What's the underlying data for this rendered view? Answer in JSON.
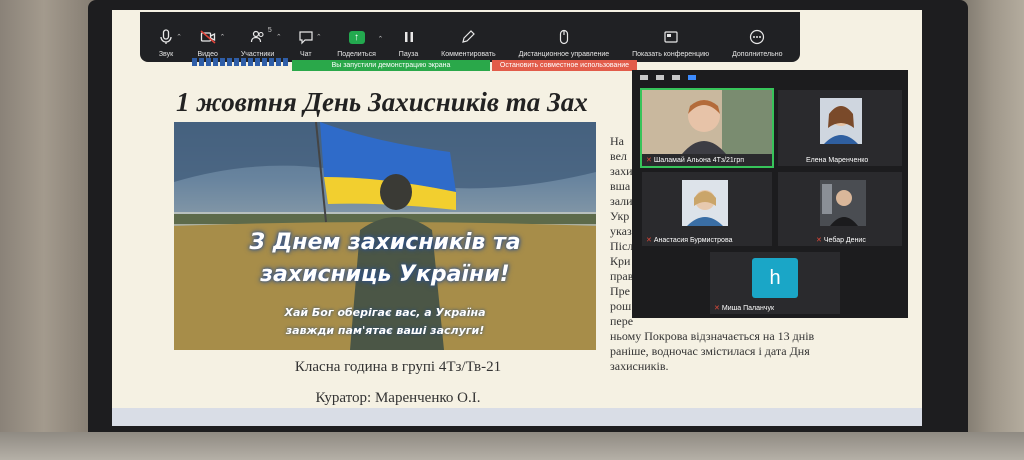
{
  "toolbar": {
    "audio": "Звук",
    "video": "Видео",
    "participants": "Участники",
    "participants_count": "5",
    "chat": "Чат",
    "share": "Поделиться",
    "pause": "Пауза",
    "annotate": "Комментировать",
    "remote_control": "Дистанционное управление",
    "show_conference": "Показать конференцию",
    "more": "Дополнительно"
  },
  "banners": {
    "sharing": "Вы запустили демонстрацию экрана",
    "stop": "Остановить совместное использование"
  },
  "slide": {
    "title": "1 жовтня День Захисників та Зах",
    "hero_line1": "З Днем захисників та",
    "hero_line2": "захисниць України!",
    "hero_sub1": "Хай Бог оберігає вас, а Україна",
    "hero_sub2": "завжди пам'ятає ваші заслуги!",
    "body_lines": [
      "На",
      "вел",
      "захи",
      "вша",
      "зали",
      "Укр",
      "указ",
      "Післ",
      "Кри",
      "прав",
      "Пре",
      "рош",
      "пере",
      "ньому Покрова відзначається на 13 днів",
      "раніше, водночас змістилася і дата Дня",
      "захисників."
    ],
    "caption1": "Класна година в групі 4Тз/Тв-21",
    "caption2": "Куратор: Маренченко О.І."
  },
  "participants": [
    {
      "name": "Шаламай Альона 4Тз/21грп",
      "muted": true
    },
    {
      "name": "Елена Маренченко",
      "muted": false
    },
    {
      "name": "Анастасия Бурмистрова",
      "muted": true
    },
    {
      "name": "Чебар Денис",
      "muted": true
    },
    {
      "name": "Миша Паланчук",
      "muted": true,
      "initial": "h"
    }
  ]
}
